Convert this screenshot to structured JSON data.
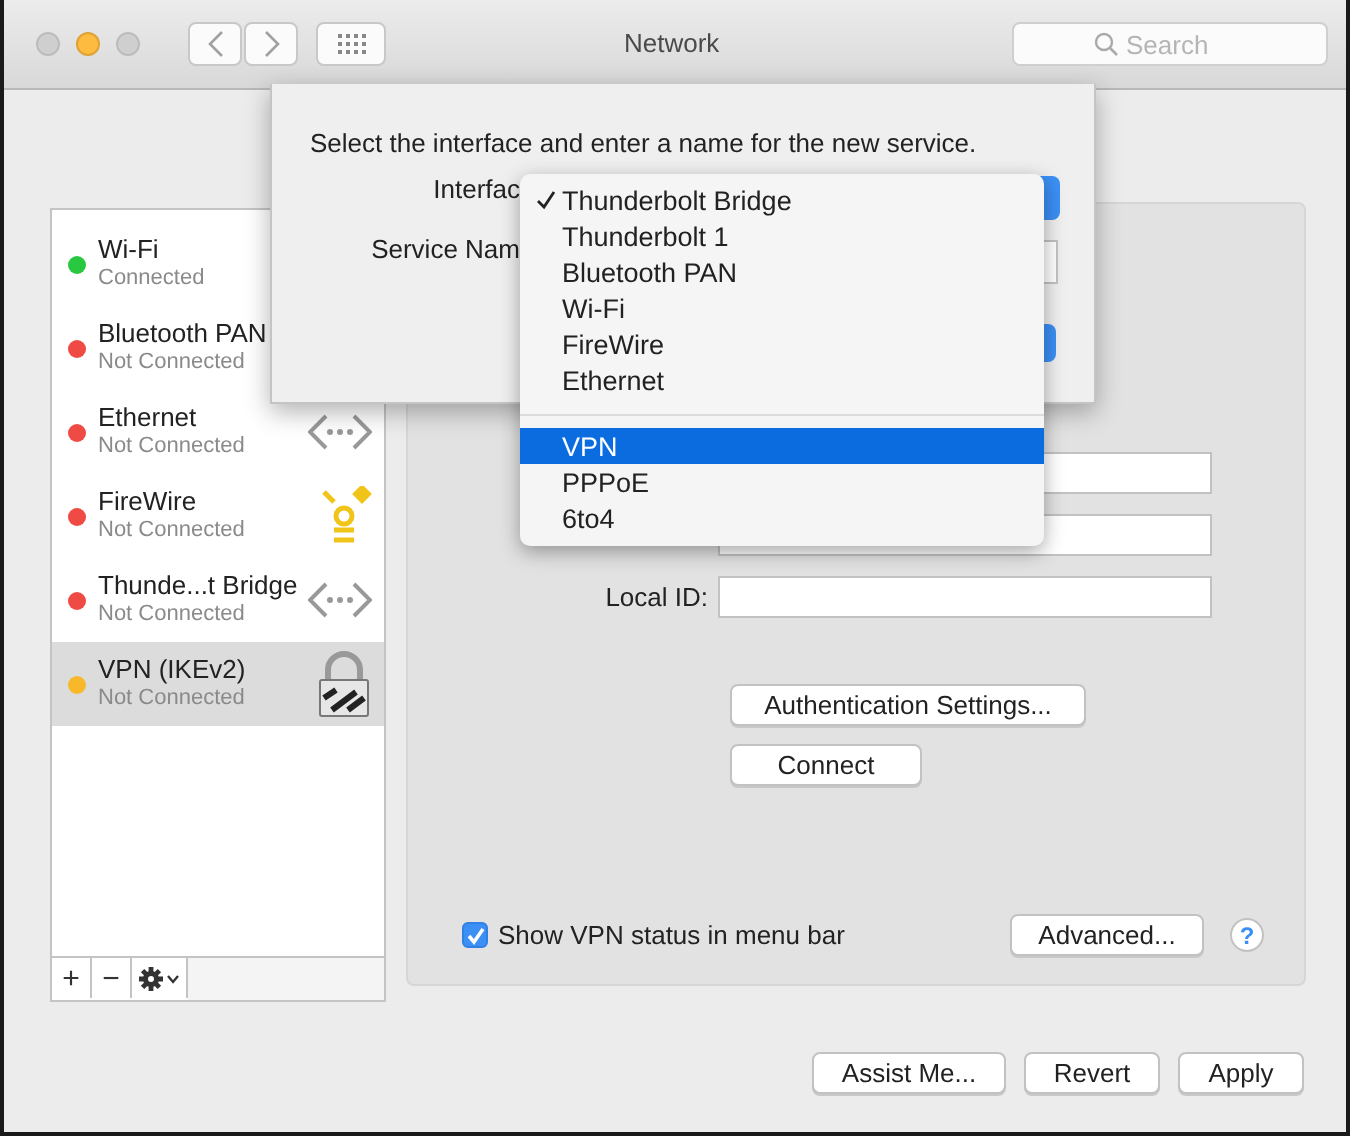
{
  "window": {
    "title": "Network"
  },
  "search": {
    "placeholder": "Search"
  },
  "services": [
    {
      "name": "Wi-Fi",
      "status": "Connected",
      "color": "#28c840",
      "kind": "plain",
      "selected": false
    },
    {
      "name": "Bluetooth PAN",
      "status": "Not Connected",
      "color": "#f04a45",
      "kind": "plain",
      "selected": false
    },
    {
      "name": "Ethernet",
      "status": "Not Connected",
      "color": "#f04a45",
      "kind": "wired",
      "selected": false
    },
    {
      "name": "FireWire",
      "status": "Not Connected",
      "color": "#f04a45",
      "kind": "firewire",
      "selected": false
    },
    {
      "name": "Thunde...t Bridge",
      "status": "Not Connected",
      "color": "#f04a45",
      "kind": "wired",
      "selected": false
    },
    {
      "name": "VPN (IKEv2)",
      "status": "Not Connected",
      "color": "#f7b82a",
      "kind": "vpn",
      "selected": true
    }
  ],
  "list_buttons": [
    "+",
    "−"
  ],
  "panel": {
    "fields": [
      {
        "kind": "covered"
      },
      {
        "kind": "covered"
      },
      {
        "kind": "labeled",
        "label": "Local ID:"
      }
    ],
    "buttons": [
      "Authentication Settings...",
      "Connect"
    ],
    "checkbox": {
      "label": "Show VPN status in menu bar",
      "checked": true
    },
    "advanced": "Advanced...",
    "help": "?"
  },
  "footer": [
    "Assist Me...",
    "Revert",
    "Apply"
  ],
  "sheet": {
    "prompt": "Select the interface and enter a name for the new service.",
    "labels": [
      "Interfac",
      "Service Nam"
    ]
  },
  "menu": [
    {
      "kind": "item",
      "label": "Thunderbolt Bridge",
      "checked": true,
      "selected": false
    },
    {
      "kind": "item",
      "label": "Thunderbolt 1",
      "checked": false,
      "selected": false
    },
    {
      "kind": "item",
      "label": "Bluetooth PAN",
      "checked": false,
      "selected": false
    },
    {
      "kind": "item",
      "label": "Wi-Fi",
      "checked": false,
      "selected": false
    },
    {
      "kind": "item",
      "label": "FireWire",
      "checked": false,
      "selected": false
    },
    {
      "kind": "item",
      "label": "Ethernet",
      "checked": false,
      "selected": false
    },
    {
      "kind": "separator"
    },
    {
      "kind": "item",
      "label": "VPN",
      "checked": false,
      "selected": true
    },
    {
      "kind": "item",
      "label": "PPPoE",
      "checked": false,
      "selected": false
    },
    {
      "kind": "item",
      "label": "6to4",
      "checked": false,
      "selected": false
    }
  ]
}
